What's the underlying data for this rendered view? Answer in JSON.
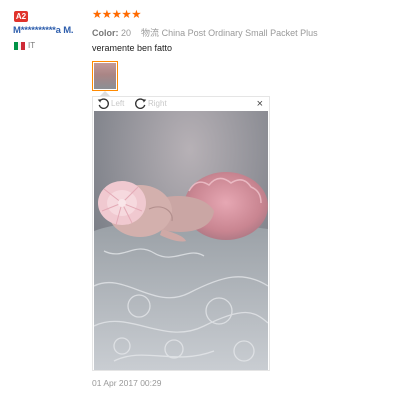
{
  "reviewer": {
    "badge": "A2",
    "name": "M**********a M.",
    "country": "IT",
    "flag_colors": [
      "#009246",
      "#ffffff",
      "#ce2b37"
    ]
  },
  "review": {
    "stars": "★★★★★",
    "rating": 5,
    "star_color": "#ff6a00",
    "color_label": "Color:",
    "color_value": "20",
    "shipping_label": "物流",
    "shipping_value": "China Post Ordinary Small Packet Plus",
    "text": "veramente ben fatto",
    "date": "01 Apr 2017 00:29"
  },
  "viewer": {
    "rotate_left_label": "Left",
    "rotate_right_label": "Right",
    "close_label": "×",
    "rotate_left_icon": "rotate-ccw-icon",
    "rotate_right_icon": "rotate-cw-icon",
    "close_icon": "close-icon",
    "thumbnail_border_color": "#ff8a00"
  }
}
